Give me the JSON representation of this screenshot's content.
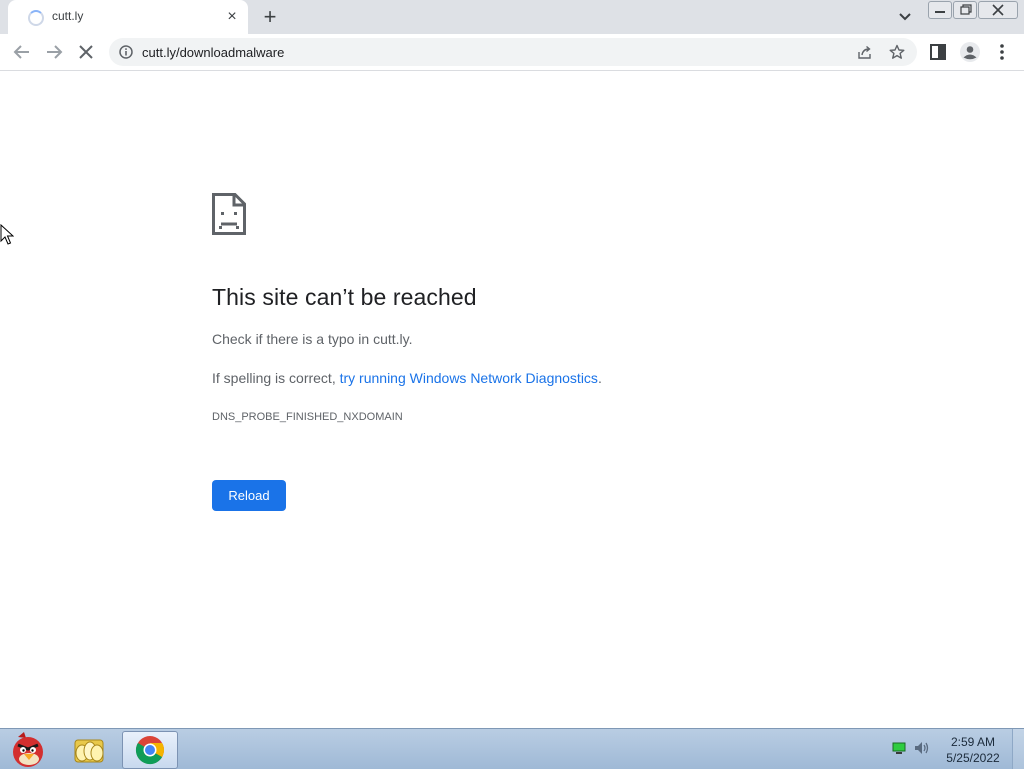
{
  "browser": {
    "tab": {
      "title": "cutt.ly",
      "close_label": "×"
    },
    "new_tab_label": "+",
    "address": {
      "url": "cutt.ly/downloadmalware"
    }
  },
  "error_page": {
    "title": "This site can’t be reached",
    "typo_hint": "Check if there is a typo in cutt.ly.",
    "spelling_prefix": "If spelling is correct, ",
    "diagnostics_link": "try running Windows Network Diagnostics",
    "spelling_suffix": ".",
    "error_code": "DNS_PROBE_FINISHED_NXDOMAIN",
    "reload_label": "Reload"
  },
  "taskbar": {
    "time": "2:59 AM",
    "date": "5/25/2022",
    "apps": [
      "angry-birds-icon",
      "file-explorer-icon",
      "chrome-icon"
    ]
  },
  "colors": {
    "accent": "#1a73e8",
    "tabstrip": "#dee1e6",
    "text": "#202124",
    "secondary_text": "#5f6368"
  }
}
